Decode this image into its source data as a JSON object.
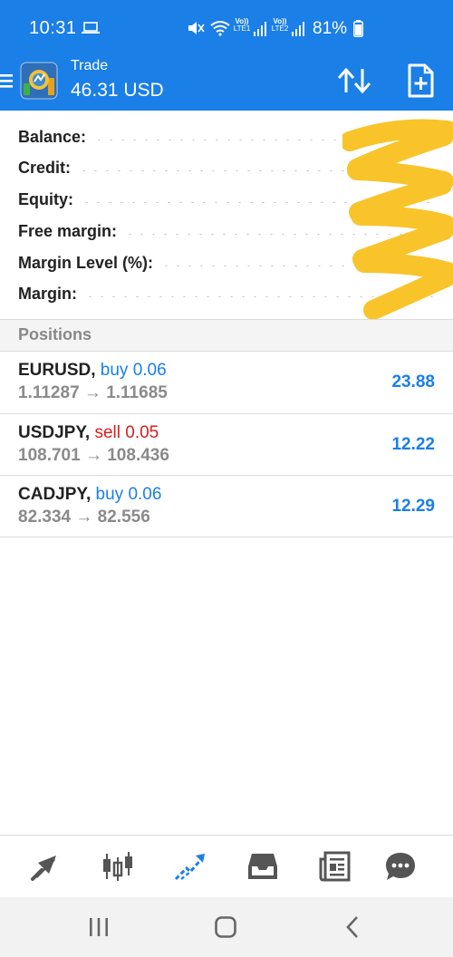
{
  "status_bar": {
    "time": "10:31",
    "battery": "81%",
    "sim1": "LTE1",
    "sim2": "LTE2"
  },
  "app_bar": {
    "title": "Trade",
    "subtitle": "46.31 USD"
  },
  "summary": [
    {
      "label": "Balance:"
    },
    {
      "label": "Credit:"
    },
    {
      "label": "Equity:"
    },
    {
      "label": "Free margin:"
    },
    {
      "label": "Margin Level (%):"
    },
    {
      "label": "Margin:"
    }
  ],
  "positions": {
    "header": "Positions",
    "items": [
      {
        "symbol": "EURUSD,",
        "side": "buy 0.06",
        "type": "buy",
        "prices": "1.11287 → 1.11685",
        "profit": "23.88"
      },
      {
        "symbol": "USDJPY,",
        "side": "sell 0.05",
        "type": "sell",
        "prices": "108.701 → 108.436",
        "profit": "12.22"
      },
      {
        "symbol": "CADJPY,",
        "side": "buy 0.06",
        "type": "buy",
        "prices": "82.334 → 82.556",
        "profit": "12.29"
      }
    ]
  },
  "bottom_nav": {
    "items": [
      "quotes-icon",
      "chart-icon",
      "trade-icon",
      "history-icon",
      "news-icon",
      "chat-icon"
    ],
    "active": "trade-icon"
  },
  "colors": {
    "primary": "#1a7fe6",
    "sell": "#d42020",
    "muted": "#8a8a8a",
    "redaction": "#f8c42a"
  }
}
